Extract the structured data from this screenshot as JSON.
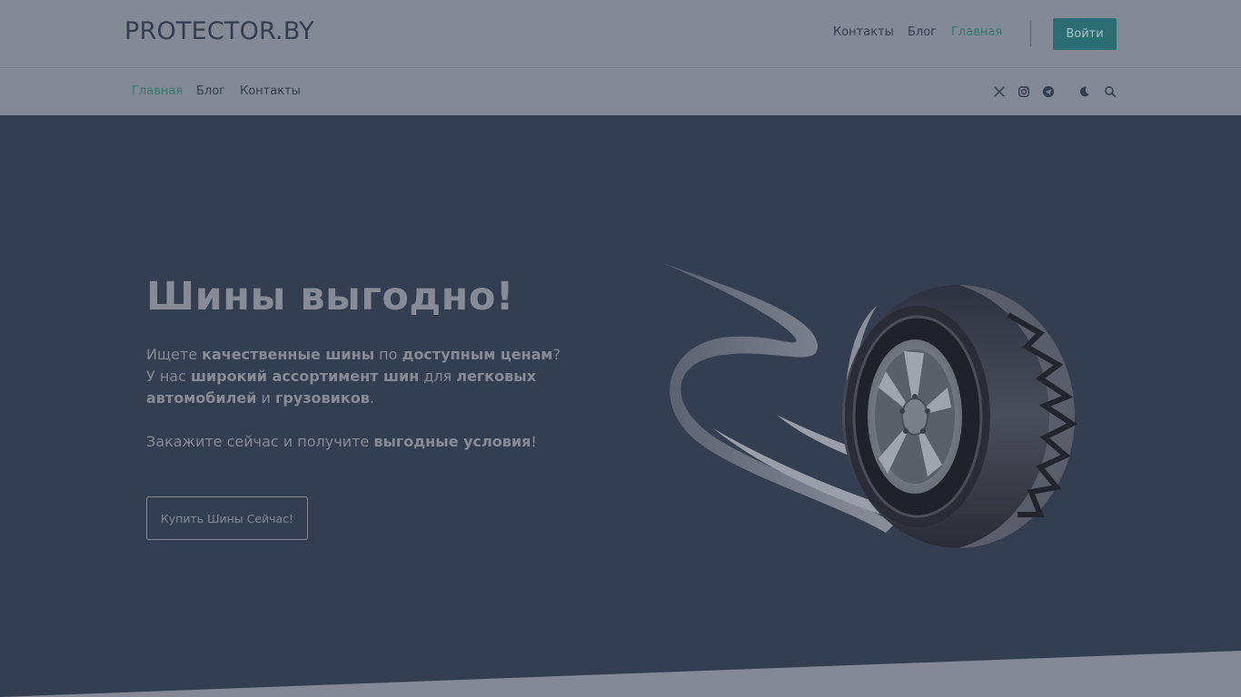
{
  "header": {
    "brand": "PROTECTOR.BY",
    "nav": [
      {
        "label": "Контакты",
        "active": false
      },
      {
        "label": "Блог",
        "active": false
      },
      {
        "label": "Главная",
        "active": true
      }
    ],
    "login_label": "Войти"
  },
  "subnav": {
    "items": [
      {
        "label": "Главная",
        "active": true
      },
      {
        "label": "Блог",
        "active": false
      },
      {
        "label": "Контакты",
        "active": false
      }
    ],
    "icons": [
      "x-twitter-icon",
      "instagram-icon",
      "telegram-icon",
      "moon-icon",
      "search-icon"
    ]
  },
  "hero": {
    "title": "Шины выгодно!",
    "line1": {
      "a": "Ищете ",
      "b": "качественные шины",
      "c": " по ",
      "d": "доступным ценам",
      "e": "?"
    },
    "line2": {
      "a": "У нас ",
      "b": "широкий ассортимент шин",
      "c": " для ",
      "d": "легковых автомобилей",
      "e": " и ",
      "f": "грузовиков",
      "g": "."
    },
    "line3": {
      "a": "Закажите сейчас и получите ",
      "b": "выгодные условия",
      "c": "!"
    },
    "cta_label": "Купить Шины Сейчас!",
    "image": "tire-illustration"
  },
  "colors": {
    "header_bg": "#838995",
    "hero_bg": "#333e51",
    "accent": "#2a6e74",
    "active_link": "#2f7d6c",
    "muted_text": "#868b96"
  }
}
